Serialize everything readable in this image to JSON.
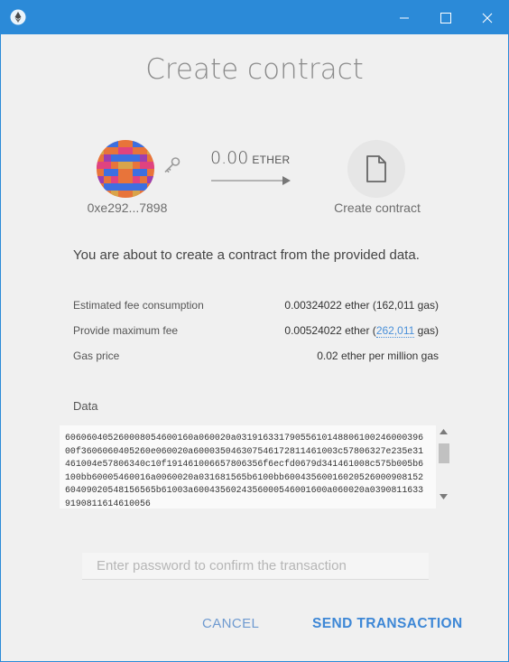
{
  "window": {
    "accent": "#2b8ad8"
  },
  "title": "Create contract",
  "from": {
    "address": "0xe292...7898"
  },
  "amount": {
    "value": "0.00",
    "unit": "ETHER"
  },
  "to": {
    "label": "Create contract"
  },
  "description": "You are about to create a contract from the provided data.",
  "fees": {
    "estimated_label": "Estimated fee consumption",
    "estimated_value": "0.00324022 ether (162,011 gas)",
    "max_label": "Provide maximum fee",
    "max_prefix": "0.00524022 ether (",
    "max_gas_link": "262,011",
    "max_suffix": " gas)",
    "gas_price_label": "Gas price",
    "gas_price_value": "0.02 ether per million gas"
  },
  "data": {
    "label": "Data",
    "value": "606060405260008054600160a060020a0319163317905561014880610024600039600f3606060405260e060020a600035046307546172811461003c57806327e235e31461004e57806340c10f191461006657806356f6ecfd0679d341461008c575b005b6100bb60005460016a0060020a031681565b6100bb6004356001602052600090815260409020548156565b61003a6004356024356000546001600a060020a03908116339190811614610056"
  },
  "password": {
    "placeholder": "Enter password to confirm the transaction",
    "value": ""
  },
  "buttons": {
    "cancel": "CANCEL",
    "send": "SEND TRANSACTION"
  }
}
